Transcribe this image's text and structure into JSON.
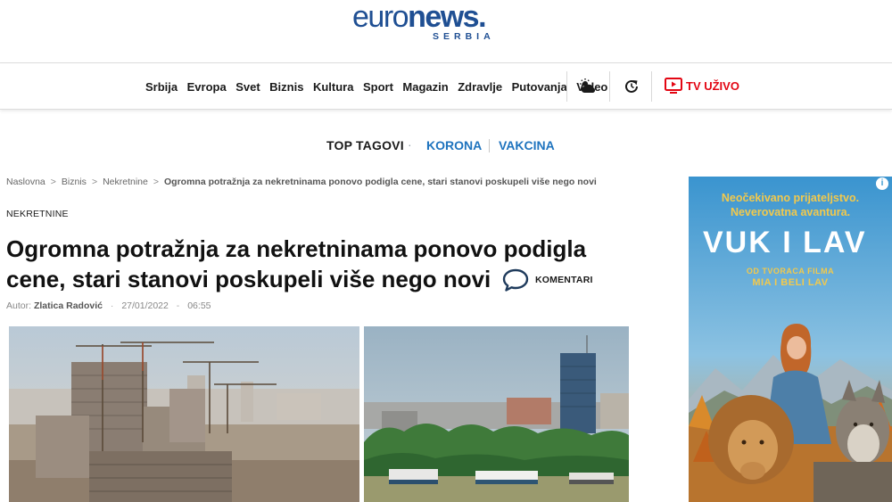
{
  "logo": {
    "part1": "euro",
    "part2": "news",
    "dot": ".",
    "edition": "SERBIA"
  },
  "nav": {
    "items": [
      "Srbija",
      "Evropa",
      "Svet",
      "Biznis",
      "Kultura",
      "Sport",
      "Magazin",
      "Zdravlje",
      "Putovanja",
      "Video"
    ],
    "weather_icon": "weather-cloud-sun-icon",
    "refresh_icon": "refresh-icon",
    "tv_label": "TV UŽIVO",
    "tv_color": "#e30613"
  },
  "top_tags": {
    "title": "TOP TAGOVI",
    "separator": "·",
    "tags": [
      "KORONA",
      "VAKCINA"
    ],
    "tag_color": "#1e73be"
  },
  "breadcrumb": {
    "items": [
      "Naslovna",
      "Biznis",
      "Nekretnine"
    ],
    "separator": ">",
    "current": "Ogromna potražnja za nekretninama ponovo podigla cene, stari stanovi poskupeli više nego novi"
  },
  "article": {
    "category": "NEKRETNINE",
    "title": "Ogromna potražnja za nekretninama ponovo podigla cene, stari stanovi poskupeli više nego novi",
    "comments_label": "KOMENTARI",
    "author_prefix": "Autor:",
    "author": "Zlatica Radović",
    "date": "27/01/2022",
    "time_sep": "-",
    "time": "06:55"
  },
  "ad": {
    "tagline1": "Neočekivano prijateljstvo.",
    "tagline2": "Neverovatna avantura.",
    "title": "VUK I LAV",
    "sub1": "OD TVORACA FILMA",
    "sub2": "MIA I BELI LAV",
    "info": "i"
  },
  "colors": {
    "brand": "#1f4f93",
    "accent": "#e30613",
    "link": "#1e73be"
  }
}
